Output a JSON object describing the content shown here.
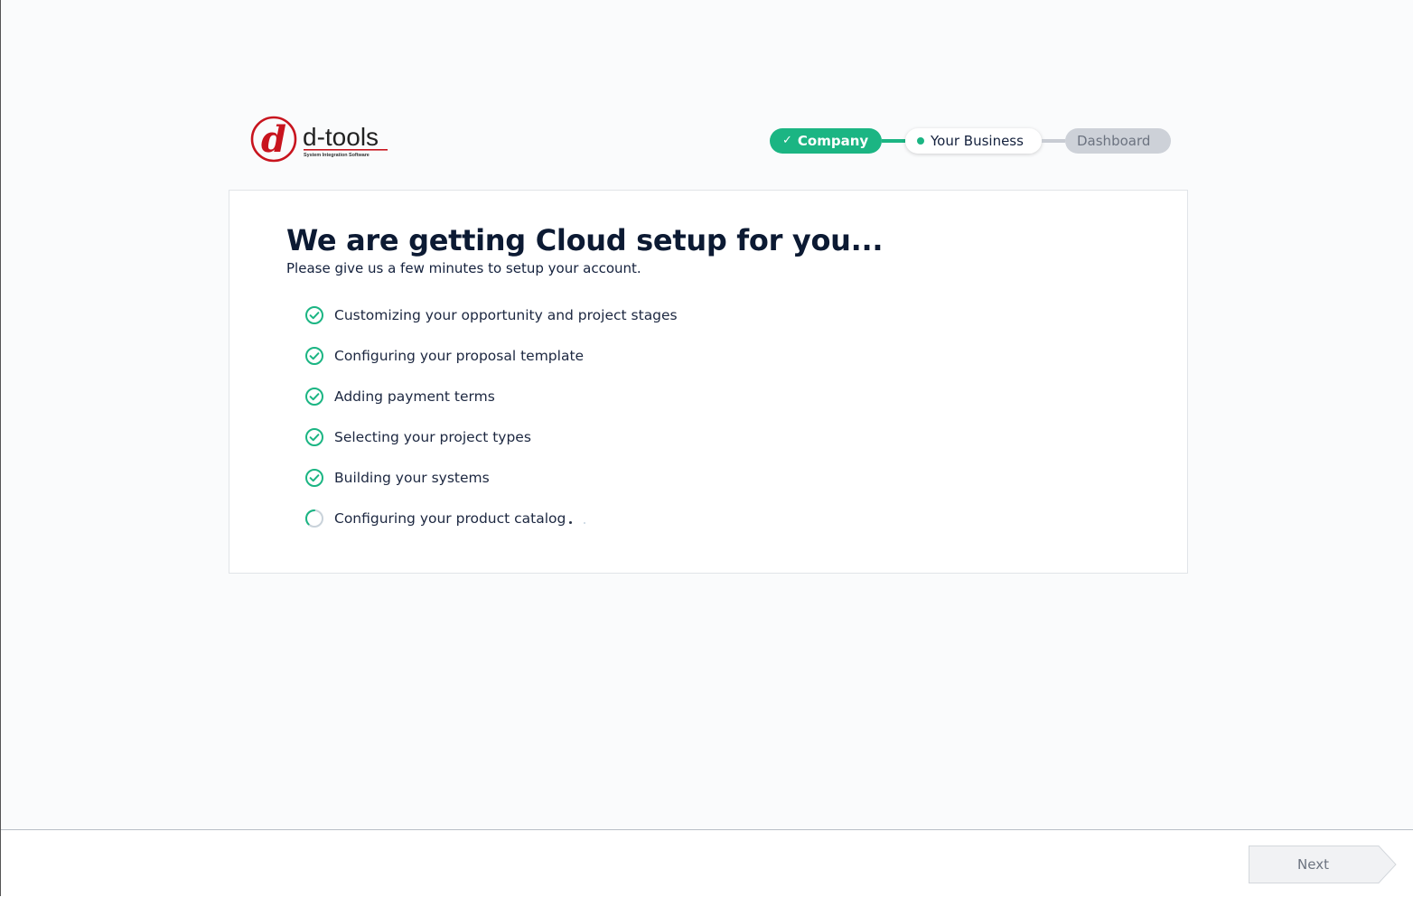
{
  "brand": {
    "logo_letter": "d",
    "logo_name": "d-tools",
    "logo_tagline": "System Integration Software",
    "logo_color": "#c8141e"
  },
  "stepper": {
    "steps": [
      {
        "label": "Company",
        "state": "completed"
      },
      {
        "label": "Your Business",
        "state": "current"
      },
      {
        "label": "Dashboard",
        "state": "pending"
      }
    ],
    "accent": "#1bb583"
  },
  "setup": {
    "title": "We are getting Cloud setup for you...",
    "subtitle": "Please give us a few minutes to setup your account.",
    "tasks": [
      {
        "label": "Customizing your opportunity and project stages",
        "status": "done",
        "icon": "check-circle-icon"
      },
      {
        "label": "Configuring your proposal template",
        "status": "done",
        "icon": "check-circle-icon"
      },
      {
        "label": "Adding payment terms",
        "status": "done",
        "icon": "check-circle-icon"
      },
      {
        "label": "Selecting your project types",
        "status": "done",
        "icon": "check-circle-icon"
      },
      {
        "label": "Building your systems",
        "status": "done",
        "icon": "check-circle-icon"
      },
      {
        "label": "Configuring your product catalog",
        "status": "in-progress",
        "icon": "spinner-icon"
      }
    ]
  },
  "footer": {
    "next_label": "Next"
  }
}
